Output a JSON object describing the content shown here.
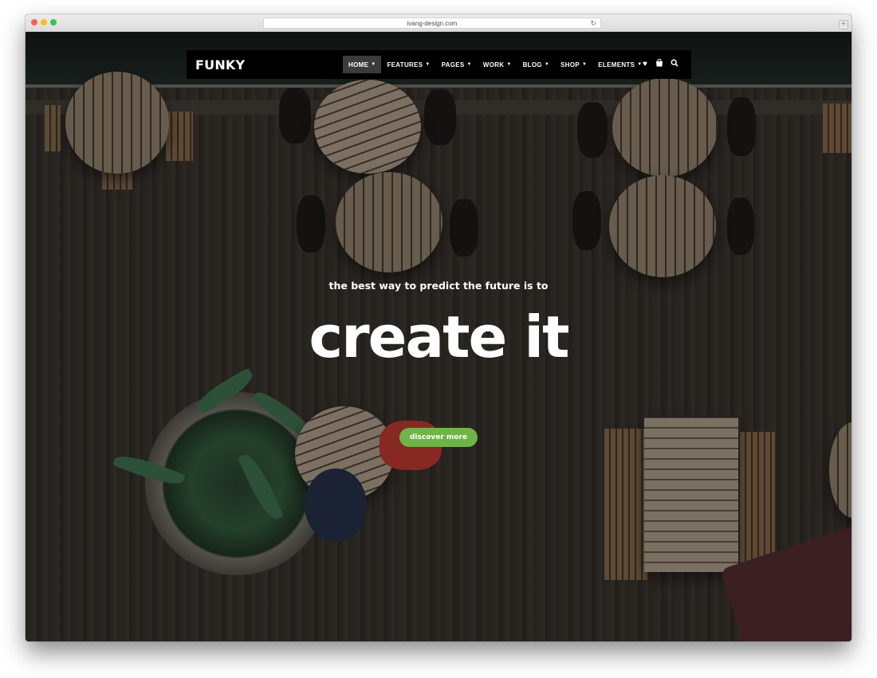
{
  "browser": {
    "url": "ivang-design.com",
    "reload_glyph": "↻",
    "new_tab_glyph": "+"
  },
  "site": {
    "logo": "FUNKY",
    "menu": [
      {
        "label": "HOME",
        "active": true
      },
      {
        "label": "FEATURES",
        "active": false
      },
      {
        "label": "PAGES",
        "active": false
      },
      {
        "label": "WORK",
        "active": false
      },
      {
        "label": "BLOG",
        "active": false
      },
      {
        "label": "SHOP",
        "active": false
      },
      {
        "label": "ELEMENTS",
        "active": false
      }
    ],
    "menu_caret": "▼",
    "icons": [
      {
        "name": "heart-icon",
        "glyph": "♥"
      },
      {
        "name": "shopping-bag-icon",
        "glyph": "🛍"
      },
      {
        "name": "search-icon",
        "glyph": "⌕"
      }
    ]
  },
  "hero": {
    "tagline": "the best way to predict the future is to",
    "headline": "create it",
    "cta_label": "discover more"
  },
  "colors": {
    "accent": "#6fb446",
    "nav_background": "#000000",
    "nav_active": "#3b3b3b"
  }
}
